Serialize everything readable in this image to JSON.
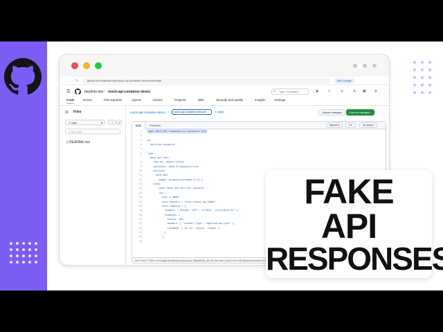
{
  "browser": {
    "url": "github.com/btadmin-tyle/mock-api-container-demo/new/main",
    "ask_label": "Ask Google"
  },
  "github": {
    "owner": "btadmin-tyle",
    "repo": "mock-api-container-demo",
    "search_placeholder": "Type / to search",
    "tabs": [
      "Code",
      "Issues",
      "Pull requests",
      "Agents",
      "Actions",
      "Projects",
      "Wiki",
      "Security and quality",
      "Insights",
      "Settings"
    ]
  },
  "sidebar": {
    "title": "Files",
    "branch": "main",
    "goto_placeholder": "Go to file",
    "files": [
      "README.md"
    ]
  },
  "main": {
    "breadcrumb_repo": "mock-api-container-demo",
    "filename": "mock-api-container-test.yml",
    "branch_tag": "main",
    "cancel_label": "Cancel changes",
    "commit_label": "Commit changes...",
    "edit_tab": "Edit",
    "preview_tab": "Preview",
    "indent_mode": "Spaces",
    "indent_size": "2",
    "wrap_mode": "No wrap",
    "footer_text": "Use Control + Shift + m to toggle the tab key moving focus. Alternatively, use esc then tab to move to the next interactive element on the page.",
    "code_lines": [
      {
        "n": "1",
        "t": "name: Mock API responses in container test",
        "hl": true
      },
      {
        "n": "2",
        "t": ""
      },
      {
        "n": "3",
        "t": "on:"
      },
      {
        "n": "4",
        "t": "  workflow_dispatch:"
      },
      {
        "n": "5",
        "t": ""
      },
      {
        "n": "6",
        "t": "jobs:"
      },
      {
        "n": "7",
        "t": "  mock-api-test:"
      },
      {
        "n": "8",
        "t": "    runs-on: ubuntu-latest"
      },
      {
        "n": "9",
        "t": "    container: node:22-bookworm-slim"
      },
      {
        "n": "10",
        "t": "    services:"
      },
      {
        "n": "11",
        "t": "      mock-api:"
      },
      {
        "n": "12",
        "t": "        image: wiremock/wiremock:3.13.2"
      },
      {
        "n": "13",
        "t": "    steps:"
      },
      {
        "n": "14",
        "t": "      - name: Mock and test API response"
      },
      {
        "n": "15",
        "t": "        run: |"
      },
      {
        "n": "16",
        "t": "          node <<'NODE'"
      },
      {
        "n": "17",
        "t": "          const BaseUrl = \"http://mock-api:8080\";"
      },
      {
        "n": "18",
        "t": "          const mapping = {"
      },
      {
        "n": "19",
        "t": "            request: { method: \"GET\", urlPath: \"/v1/orders/42\" },"
      },
      {
        "n": "20",
        "t": "            response: {"
      },
      {
        "n": "21",
        "t": "              status: 200,"
      },
      {
        "n": "22",
        "t": "              headers: { \"Content-Type\": \"application/json\" },"
      },
      {
        "n": "23",
        "t": "              jsonBody: { id: 42, status: \"ready\" }"
      },
      {
        "n": "24",
        "t": "            }"
      },
      {
        "n": "25",
        "t": "          };"
      },
      {
        "n": "26",
        "t": ""
      }
    ]
  },
  "headline": {
    "line1": "FAKE",
    "line2": "API",
    "line3": "RESPONSES"
  },
  "colors": {
    "accent_purple": "#7b5cf5",
    "commit_green": "#1f883d"
  }
}
